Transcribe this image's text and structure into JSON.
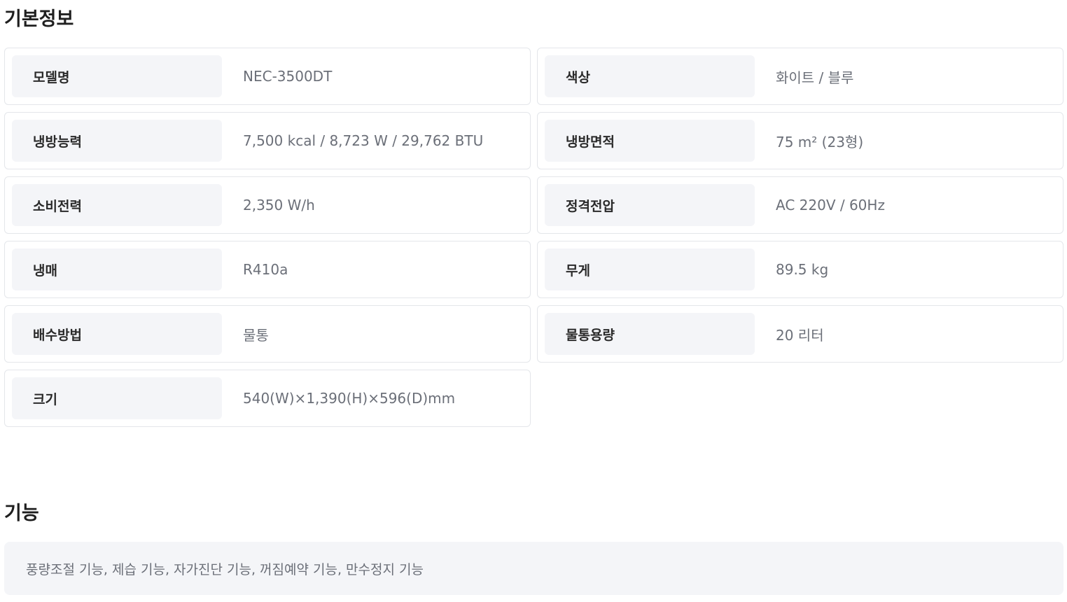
{
  "basic_info": {
    "title": "기본정보",
    "specs": [
      {
        "label": "모델명",
        "value": "NEC-3500DT"
      },
      {
        "label": "색상",
        "value": "화이트 / 블루"
      },
      {
        "label": "냉방능력",
        "value": "7,500 kcal / 8,723 W / 29,762 BTU"
      },
      {
        "label": "냉방면적",
        "value": "75 m² (23형)"
      },
      {
        "label": "소비전력",
        "value": "2,350 W/h"
      },
      {
        "label": "정격전압",
        "value": "AC 220V / 60Hz"
      },
      {
        "label": "냉매",
        "value": "R410a"
      },
      {
        "label": "무게",
        "value": "89.5 kg"
      },
      {
        "label": "배수방법",
        "value": "물통"
      },
      {
        "label": "물통용량",
        "value": "20 리터"
      },
      {
        "label": "크기",
        "value": "540(W)×1,390(H)×596(D)mm"
      }
    ]
  },
  "features": {
    "title": "기능",
    "text": "풍량조절 기능, 제습 기능, 자가진단 기능, 꺼짐예약 기능, 만수정지 기능"
  }
}
